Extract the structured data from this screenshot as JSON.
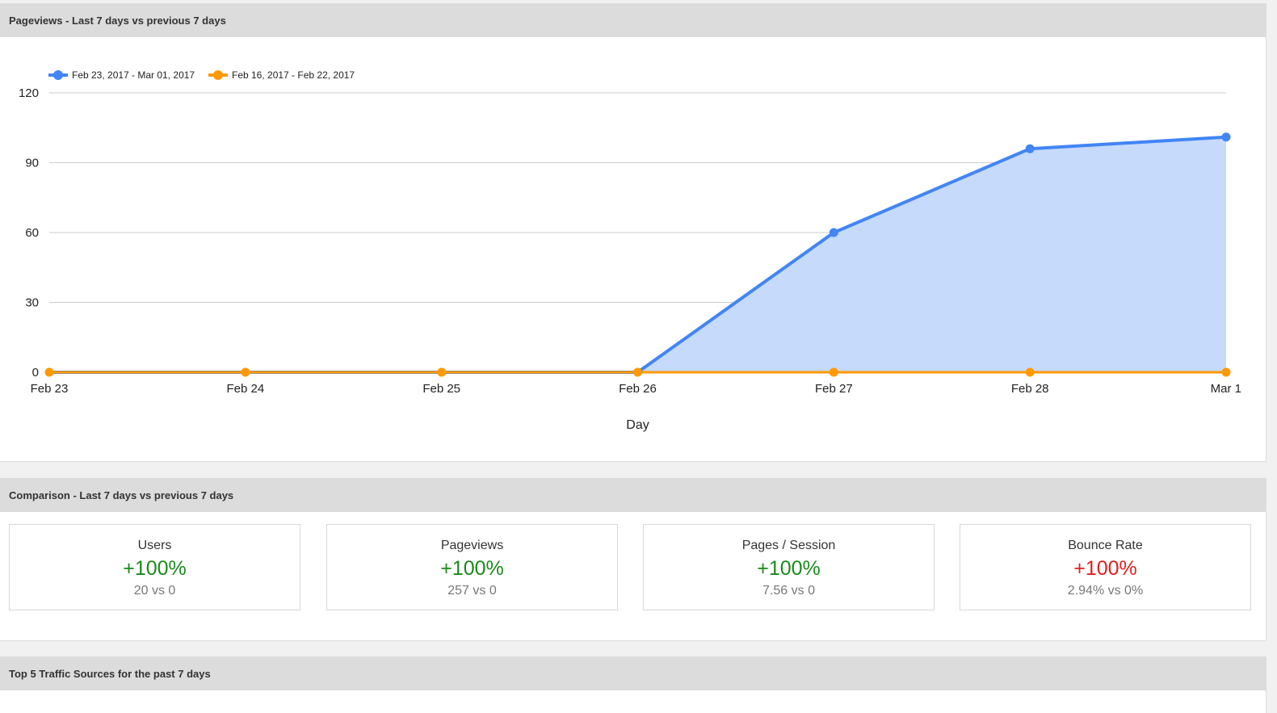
{
  "pageviews_panel": {
    "title": "Pageviews - Last 7 days vs previous 7 days"
  },
  "chart_data": {
    "type": "area",
    "xlabel": "Day",
    "ylabel": "",
    "categories": [
      "Feb 23",
      "Feb 24",
      "Feb 25",
      "Feb 26",
      "Feb 27",
      "Feb 28",
      "Mar 1"
    ],
    "ylim": [
      0,
      120
    ],
    "yticks": [
      "0",
      "30",
      "60",
      "90",
      "120"
    ],
    "grid": true,
    "legend_position": "top-left",
    "series": [
      {
        "name": "Feb 23, 2017 - Mar 01, 2017",
        "values": [
          0,
          0,
          0,
          0,
          60,
          96,
          101
        ],
        "color": "#4285f4",
        "fill": "#c6dafc",
        "zero_markers": false
      },
      {
        "name": "Feb 16, 2017 - Feb 22, 2017",
        "values": [
          0,
          0,
          0,
          0,
          0,
          0,
          0
        ],
        "color": "#ff9900",
        "fill": null,
        "zero_markers": true
      }
    ]
  },
  "comparison_panel": {
    "title": "Comparison - Last 7 days vs previous 7 days",
    "cards": [
      {
        "title": "Users",
        "change": "+100%",
        "detail": "20 vs 0",
        "change_color": "#1a8a1a"
      },
      {
        "title": "Pageviews",
        "change": "+100%",
        "detail": "257 vs 0",
        "change_color": "#1a8a1a"
      },
      {
        "title": "Pages / Session",
        "change": "+100%",
        "detail": "7.56 vs 0",
        "change_color": "#1a8a1a"
      },
      {
        "title": "Bounce Rate",
        "change": "+100%",
        "detail": "2.94% vs 0%",
        "change_color": "#e0201f"
      }
    ]
  },
  "traffic_panel": {
    "title": "Top 5 Traffic Sources for the past 7 days"
  }
}
